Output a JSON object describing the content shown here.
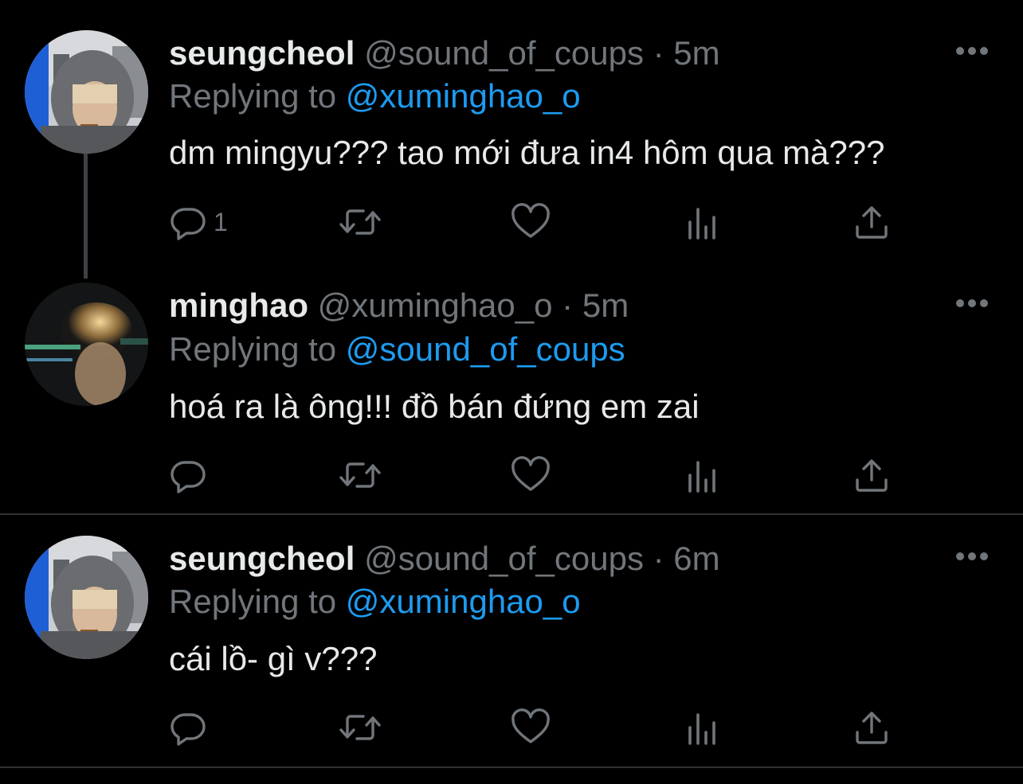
{
  "colors": {
    "background": "#000000",
    "text": "#e7e9ea",
    "muted": "#71767b",
    "link": "#1d9bf0",
    "separator": "#2f3336"
  },
  "separator_text": "·",
  "tweets": [
    {
      "name": "seungcheol",
      "handle": "@sound_of_coups",
      "time": "5m",
      "replying_prefix": "Replying to ",
      "replying_to": "@xuminghao_o",
      "text": "dm mingyu??? tao mới đưa in4 hôm qua mà???",
      "reply_count": "1",
      "avatar": "avatar-seungcheol",
      "icons": [
        "reply-icon",
        "retweet-icon",
        "like-icon",
        "views-icon",
        "share-icon",
        "more-icon"
      ]
    },
    {
      "name": "minghao",
      "handle": "@xuminghao_o",
      "time": "5m",
      "replying_prefix": "Replying to ",
      "replying_to": "@sound_of_coups",
      "text": "hoá ra là ông!!! đồ bán đứng em zai",
      "reply_count": "",
      "avatar": "avatar-minghao",
      "icons": [
        "reply-icon",
        "retweet-icon",
        "like-icon",
        "views-icon",
        "share-icon",
        "more-icon"
      ]
    },
    {
      "name": "seungcheol",
      "handle": "@sound_of_coups",
      "time": "6m",
      "replying_prefix": "Replying to ",
      "replying_to": "@xuminghao_o",
      "text": "cái lồ- gì v???",
      "reply_count": "",
      "avatar": "avatar-seungcheol",
      "icons": [
        "reply-icon",
        "retweet-icon",
        "like-icon",
        "views-icon",
        "share-icon",
        "more-icon"
      ]
    }
  ]
}
